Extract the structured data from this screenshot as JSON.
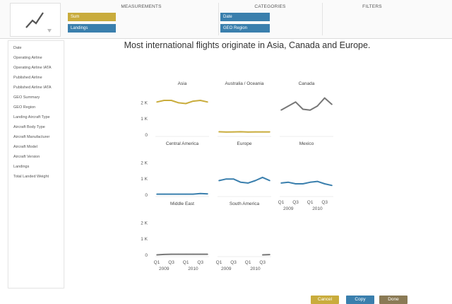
{
  "shelves": {
    "measurements": {
      "label": "MEASUREMENTS",
      "pills": [
        {
          "text": "Sum",
          "color": "#c9ac3c"
        },
        {
          "text": "Landings",
          "color": "#3a7fad"
        }
      ]
    },
    "categories": {
      "label": "CATEGORIES",
      "pills": [
        {
          "text": "Date",
          "color": "#3a7fad"
        },
        {
          "text": "GEO Region",
          "color": "#3a7fad"
        }
      ]
    },
    "filters": {
      "label": "FILTERS"
    }
  },
  "sidebar": {
    "items": [
      "Date",
      "Operating Airline",
      "Operating Airline IATA",
      "Published Airline",
      "Published Airline IATA",
      "GEO Summary",
      "GEO Region",
      "Landing Aircraft Type",
      "Aircraft Body Type",
      "Aircraft Manufacturer",
      "Aircraft Model",
      "Aircraft Version",
      "Landings",
      "Total Landed Weight"
    ]
  },
  "buttons": {
    "cancel": "Cancel",
    "copy": "Copy",
    "done": "Done"
  },
  "colors": {
    "gold": "#c9ac3c",
    "blue": "#3a7fad",
    "gray": "#777777",
    "divider": "#e3e3e3"
  },
  "chart_data": {
    "type": "line",
    "title": "Most international flights originate in Asia, Canada and Europe.",
    "y_ticks": [
      "0",
      "1 K",
      "2 K"
    ],
    "ylim": [
      0,
      2500
    ],
    "x_ticks": [
      "Q1",
      "Q3",
      "Q1",
      "Q3"
    ],
    "x_years": [
      "2009",
      "2010"
    ],
    "x": [
      "2009 Q1",
      "2009 Q2",
      "2009 Q3",
      "2009 Q4",
      "2010 Q1",
      "2010 Q2",
      "2010 Q3",
      "2010 Q4"
    ],
    "series": [
      {
        "name": "Asia",
        "color": "#c9ac3c",
        "values": [
          2050,
          2150,
          2150,
          2000,
          1950,
          2100,
          2150,
          2050
        ]
      },
      {
        "name": "Australia / Oceania",
        "color": "#c9ac3c",
        "values": [
          200,
          190,
          195,
          200,
          185,
          195,
          195,
          195
        ]
      },
      {
        "name": "Canada",
        "color": "#777777",
        "values": [
          1550,
          1800,
          2050,
          1600,
          1550,
          1800,
          2300,
          1900
        ]
      },
      {
        "name": "Central America",
        "color": "#3a7fad",
        "values": [
          60,
          60,
          60,
          60,
          60,
          60,
          100,
          80
        ]
      },
      {
        "name": "Europe",
        "color": "#3a7fad",
        "values": [
          900,
          1000,
          1000,
          800,
          750,
          900,
          1100,
          900
        ]
      },
      {
        "name": "Mexico",
        "color": "#3a7fad",
        "values": [
          750,
          800,
          700,
          700,
          800,
          850,
          700,
          600
        ]
      },
      {
        "name": "Middle East",
        "color": "#777777",
        "values": [
          20,
          50,
          60,
          60,
          60,
          60,
          60,
          60
        ]
      },
      {
        "name": "South America",
        "color": "#777777",
        "values": [
          null,
          null,
          null,
          null,
          null,
          null,
          20,
          40
        ]
      }
    ]
  }
}
